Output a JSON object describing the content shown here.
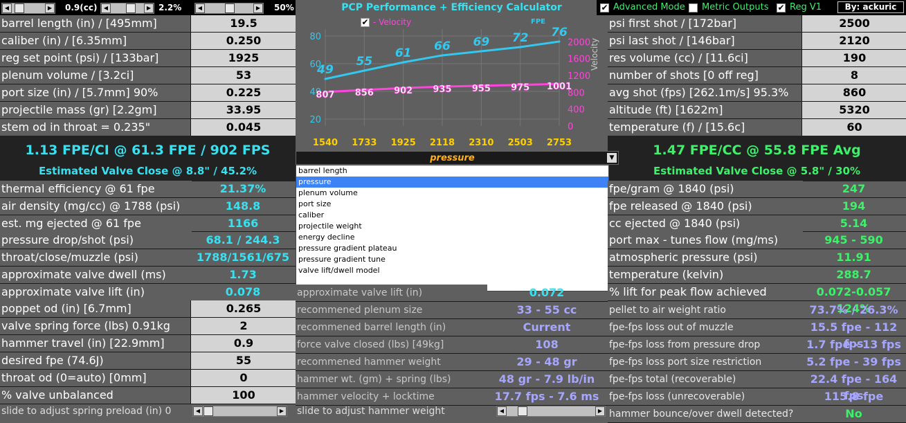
{
  "top_bar": {
    "slider1_value": "0.9(cc)",
    "slider2_value": "2.2%",
    "slider3_value": "50%",
    "app_title": "PCP Performance + Efficiency Calculator",
    "advanced_mode_label": "Advanced Mode",
    "metric_outputs_label": "Metric Outputs",
    "reg_v1_label": "Reg V1",
    "author": "By: ackuric"
  },
  "left_inputs": [
    {
      "label": "barrel length (in) / [495mm]",
      "value": "19.5"
    },
    {
      "label": "caliber (in) / [6.35mm]",
      "value": "0.250"
    },
    {
      "label": "reg set point (psi) / [133bar]",
      "value": "1925"
    },
    {
      "label": "plenum volume / [3.2ci]",
      "value": "53"
    },
    {
      "label": "port size (in) / [5.7mm] 90%",
      "value": "0.225"
    },
    {
      "label": "projectile mass (gr) [2.2gm]",
      "value": "33.95"
    },
    {
      "label": "stem od in throat = 0.235\"",
      "value": "0.045"
    }
  ],
  "right_inputs": [
    {
      "label": "psi first shot / [172bar]",
      "value": "2500"
    },
    {
      "label": "psi last shot / [146bar]",
      "value": "2120"
    },
    {
      "label": "res volume (cc) / [11.6ci]",
      "value": "190"
    },
    {
      "label": "number of shots [0 off reg]",
      "value": "8"
    },
    {
      "label": "avg shot (fps) [262.1m/s] 95.3%",
      "value": "860"
    },
    {
      "label": "altitude (ft) [1622m]",
      "value": "5320"
    },
    {
      "label": "temperature (f) / [15.6c]",
      "value": "60"
    }
  ],
  "left_banner": {
    "headline": "1.13 FPE/CI @ 61.3 FPE / 902 FPS",
    "sub": "Estimated Valve Close @ 8.8\" / 45.2%"
  },
  "right_banner": {
    "headline": "1.47 FPE/CC @ 55.8 FPE Avg",
    "sub": "Estimated Valve Close @ 5.8\" / 30%"
  },
  "left_outputs": [
    {
      "label": "thermal efficiency @ 61 fpe",
      "value": "21.37%"
    },
    {
      "label": "air density (mg/cc) @ 1788 (psi)",
      "value": "148.8"
    },
    {
      "label": "est. mg ejected @ 61 fpe",
      "value": "1166"
    },
    {
      "label": "pressure drop/shot (psi)",
      "value": "68.1 / 244.3"
    },
    {
      "label": "throat/close/muzzle (psi)",
      "value": "1788/1561/675"
    },
    {
      "label": "approximate valve dwell (ms)",
      "value": "1.73"
    },
    {
      "label": "approximate valve lift (in)",
      "value": "0.078"
    }
  ],
  "left_inputs2": [
    {
      "label": "poppet od (in) [6.7mm]",
      "value": "0.265"
    },
    {
      "label": "valve spring force (lbs) 0.91kg",
      "value": "2"
    },
    {
      "label": "hammer travel (in) [22.9mm]",
      "value": "0.9"
    },
    {
      "label": "desired fpe (74.6J)",
      "value": "55"
    },
    {
      "label": "throat od (0=auto) [0mm]",
      "value": "0"
    },
    {
      "label": "% valve unbalanced",
      "value": "100"
    }
  ],
  "left_slider_label": "slide to adjust spring preload (in) 0",
  "right_outputs": [
    {
      "label": "fpe/gram @ 1840 (psi)",
      "value": "247"
    },
    {
      "label": "fpe released @ 1840 (psi)",
      "value": "194"
    },
    {
      "label": "cc ejected @ 1840 (psi)",
      "value": "5.14"
    },
    {
      "label": "port max - tunes flow (mg/ms)",
      "value": "945 - 590"
    },
    {
      "label": "atmospheric pressure (psi)",
      "value": "11.91"
    },
    {
      "label": "temperature (kelvin)",
      "value": "288.7"
    },
    {
      "label": "% lift for peak flow achieved",
      "value": "0.072-0.057 124%"
    }
  ],
  "right_outputs2": [
    {
      "label": "pellet to air weight ratio",
      "value": "73.7% / 26.3%"
    },
    {
      "label": "fpe-fps loss out of muzzle",
      "value": "15.5 fpe - 112 fps"
    },
    {
      "label": "fpe-fps loss from pressure drop",
      "value": "1.7 fpe - 13 fps"
    },
    {
      "label": "fpe-fps loss port size restriction",
      "value": "5.2 fpe - 39 fps"
    },
    {
      "label": "fpe-fps total (recoverable)",
      "value": "22.4 fpe - 164 fps"
    },
    {
      "label": "fpe-fps loss (unrecoverable)",
      "value": "115.8 fpe"
    },
    {
      "label": "hammer bounce/over dwell detected?",
      "value": "No"
    }
  ],
  "center_outputs": [
    {
      "label": "approximate valve lift (in)",
      "value": "0.072"
    },
    {
      "label": "recommened plenum size",
      "value": "33 - 55 cc"
    },
    {
      "label": "recommened barrel length  (in)",
      "value": "Current"
    },
    {
      "label": "force valve closed (lbs) [49kg]",
      "value": "108"
    },
    {
      "label": "recommened hammer weight",
      "value": "29 - 48 gr"
    },
    {
      "label": "hammer wt. (gm) + spring (lbs)",
      "value": "48 gr - 7.9 lb/in"
    },
    {
      "label": "hammer velocity + locktime",
      "value": "17.7 fps - 7.6 ms"
    }
  ],
  "center_slider_label": "slide to adjust hammer weight",
  "dropdown": {
    "selected": "pressure",
    "options": [
      "barrel length",
      "pressure",
      "plenum volume",
      "port size",
      "caliber",
      "projectile weight",
      "energy decline",
      "pressure gradient plateau",
      "pressure gradient tune",
      "valve lift/dwell model"
    ]
  },
  "chart_data": {
    "type": "line",
    "x": [
      1540,
      1733,
      1925,
      2118,
      2310,
      2503,
      2753
    ],
    "series": [
      {
        "name": "FPE",
        "values": [
          49,
          55,
          61,
          66,
          69,
          72,
          76
        ],
        "color": "#33c8f0",
        "axis": "left"
      },
      {
        "name": "Velocity",
        "values": [
          807,
          856,
          902,
          935,
          955,
          975,
          1001
        ],
        "color": "#ff44dd",
        "axis": "right"
      }
    ],
    "left_axis": {
      "ticks": [
        "80",
        "60",
        "40",
        "20"
      ],
      "range": [
        15,
        85
      ]
    },
    "right_axis": {
      "label": "Velocity",
      "ticks": [
        "2000",
        "1600",
        "1200",
        "800",
        "400",
        "0"
      ],
      "range": [
        0,
        2300
      ]
    },
    "legend_velocity": "- Velocity",
    "legend_fpe": "FPE",
    "grid": true
  }
}
